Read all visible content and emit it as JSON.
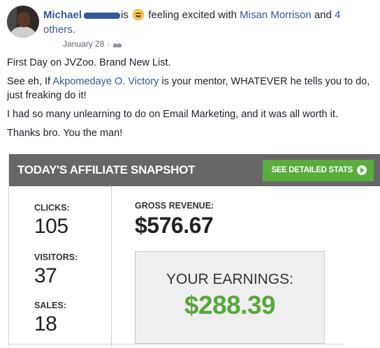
{
  "post": {
    "author": "Michael",
    "activity_prefix": "is",
    "feeling_icon": "grinning-emoji-icon",
    "activity_text": "feeling excited with",
    "tagged_person": "Misan Morrison",
    "joiner": "and",
    "others_link": "4 others.",
    "date": "January 28",
    "separator": "·",
    "privacy_icon": "friends-icon",
    "paragraphs": {
      "p1": "First Day on JVZoo. Brand New List.",
      "p2_before": "See eh, If",
      "p2_link": "Akpomedaye O. Victory",
      "p2_after": "is your mentor, WHATEVER he tells you to do, just freaking do it!",
      "p3": "I had so many unlearning to do on Email Marketing, and it was all worth it.",
      "p4": "Thanks bro. You the man!"
    }
  },
  "snapshot": {
    "title": "TODAY'S AFFILIATE SNAPSHOT",
    "stats_button": "SEE DETAILED STATS",
    "clicks_label": "CLICKS:",
    "clicks_value": "105",
    "visitors_label": "VISITORS:",
    "visitors_value": "37",
    "sales_label": "SALES:",
    "sales_value": "18",
    "gross_label": "GROSS REVENUE:",
    "gross_value": "$576.67",
    "earnings_label": "YOUR EARNINGS:",
    "earnings_value": "$288.39"
  },
  "colors": {
    "link": "#365899",
    "header_bar": "#676767",
    "button_green": "#58ad3b",
    "earnings_green": "#58a73c"
  }
}
